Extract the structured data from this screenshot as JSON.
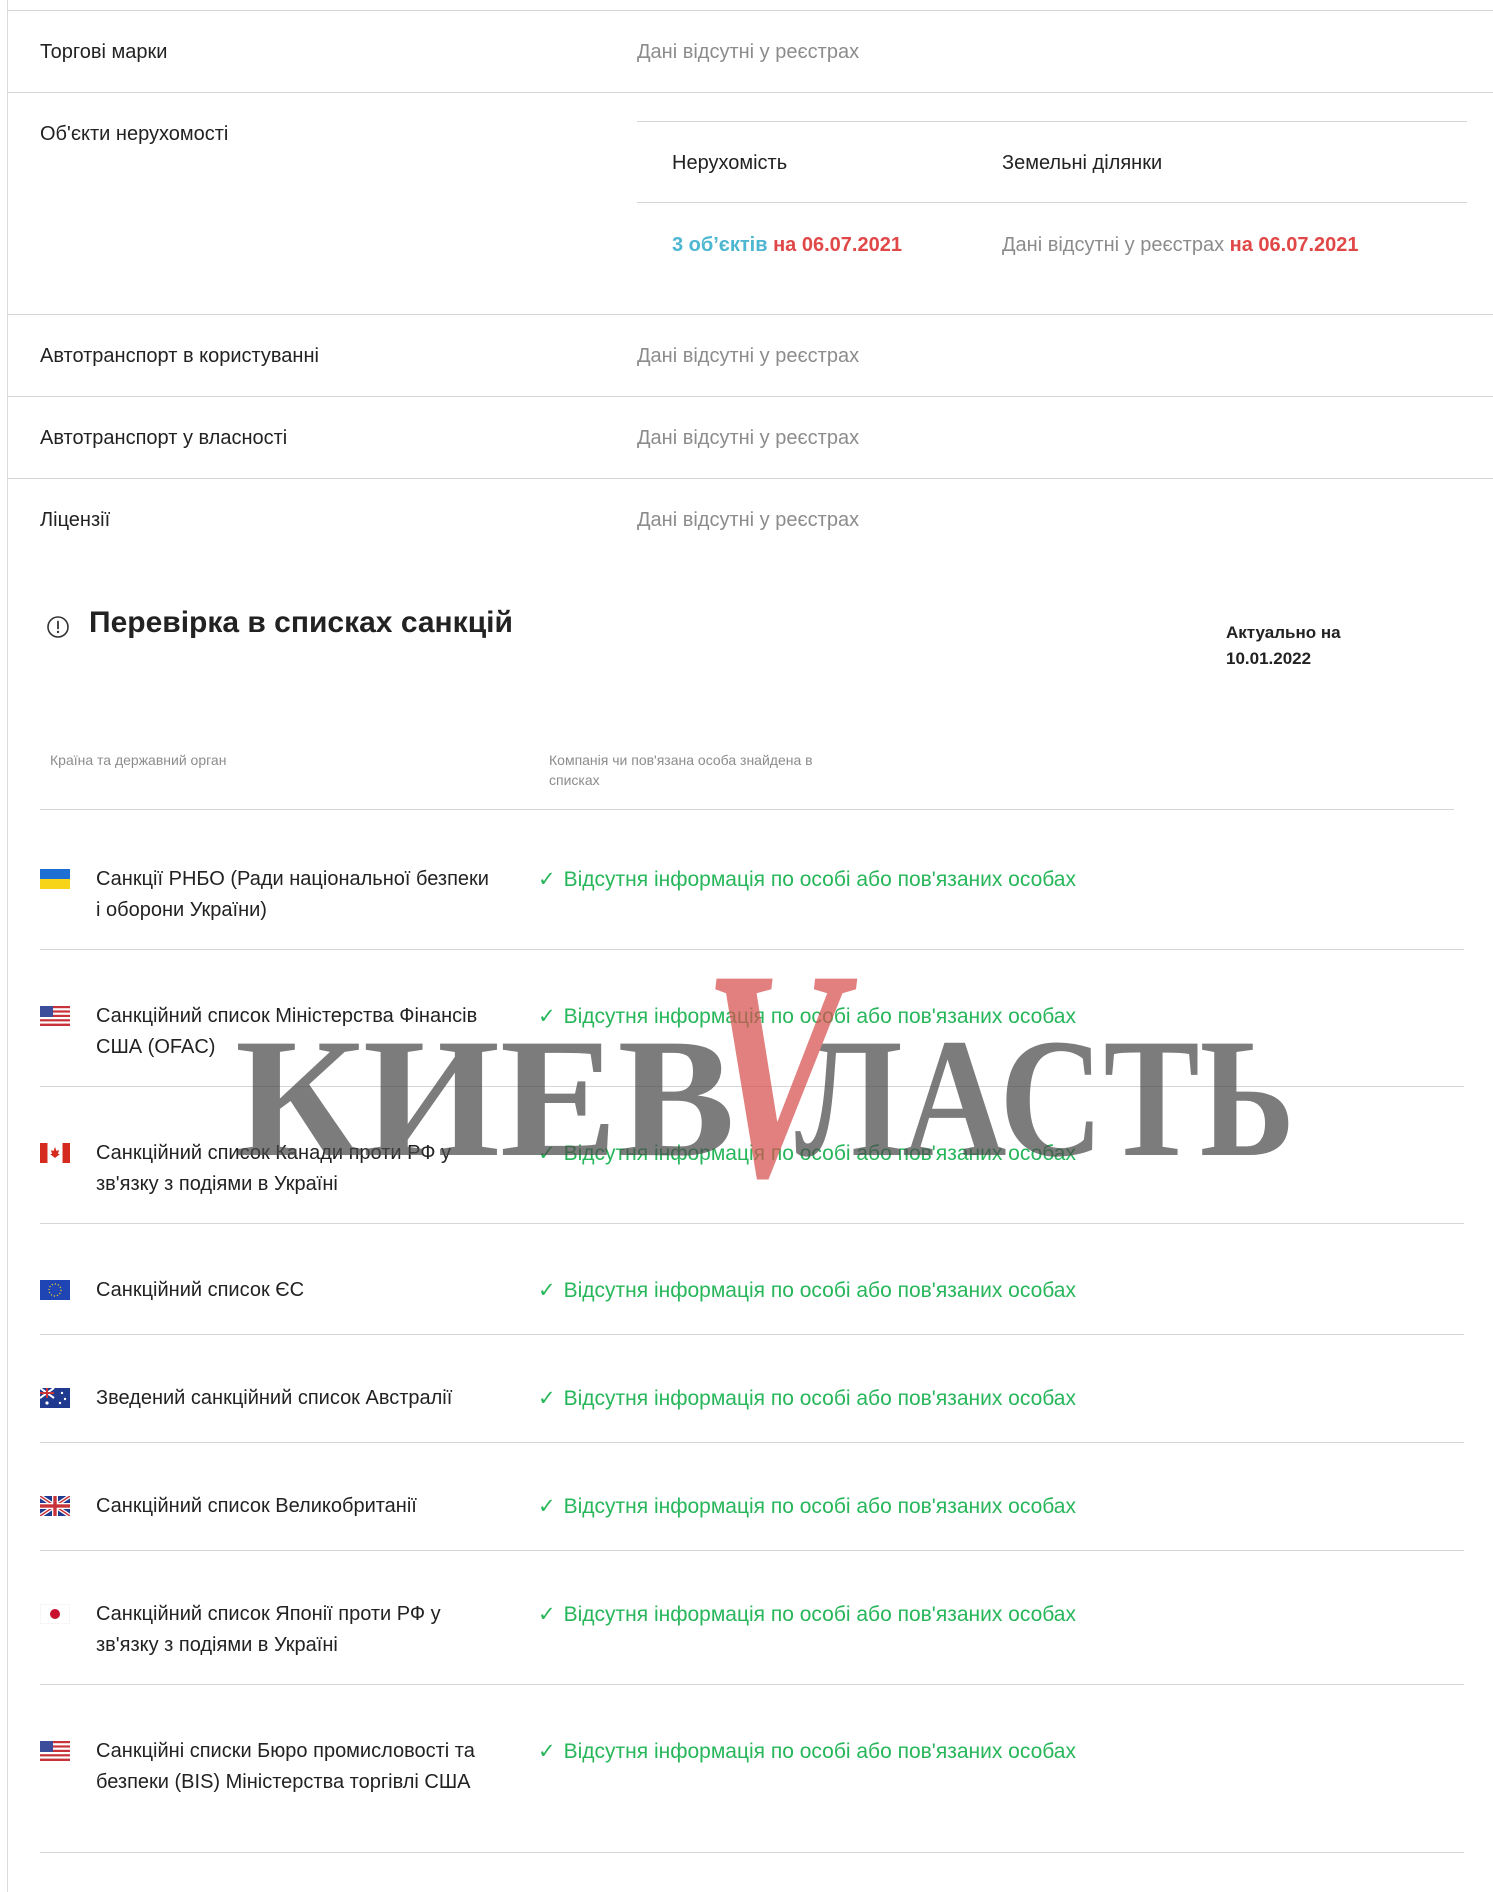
{
  "registry": {
    "no_data": "Дані відсутні у реєстрах",
    "trademarks_label": "Торгові марки",
    "real_estate_label": "Об'єкти нерухомості",
    "vehicles_use_label": "Автотранспорт в користуванні",
    "vehicles_own_label": "Автотранспорт у власності",
    "licenses_label": "Ліцензії",
    "real_estate": {
      "col_property": "Нерухомість",
      "col_land": "Земельні ділянки",
      "property_count": "3 об’єктів",
      "property_date": "на 06.07.2021",
      "land_value": "Дані відсутні у реєстрах",
      "land_date": "на 06.07.2021"
    }
  },
  "sanctions": {
    "title": "Перевірка в списках санкцій",
    "actual_label": "Актуально на",
    "actual_date": "10.01.2022",
    "col_country": "Країна та державний орган",
    "col_found_line1": "Компанія чи пов'язана особа знайдена в",
    "col_found_line2": "списках",
    "status_text": "Відсутня інформація по особі або пов'язаних особах",
    "lists": [
      {
        "name": "Санкції РНБО (Ради національної безпеки і оборони України)",
        "flag": "ukraine-flag-icon"
      },
      {
        "name": "Санкційний список Міністерства Фінансів США (OFAC)",
        "flag": "usa-flag-icon"
      },
      {
        "name": "Санкційний список Канади проти РФ у зв'язку з подіями в Україні",
        "flag": "canada-flag-icon"
      },
      {
        "name": "Санкційний список ЄС",
        "flag": "eu-flag-icon"
      },
      {
        "name": "Зведений санкційний список Австралії",
        "flag": "australia-flag-icon"
      },
      {
        "name": "Санкційний список Великобританії",
        "flag": "uk-flag-icon"
      },
      {
        "name": "Санкційний список Японії проти РФ у зв'язку з подіями в Україні",
        "flag": "japan-flag-icon"
      },
      {
        "name": "Санкційні списки Бюро промисловості та безпеки (BIS) Міністерства торгівлі США",
        "flag": "usa-flag-icon"
      }
    ]
  },
  "watermark": {
    "text": "КИЕВ ЛАСТЬ",
    "letter": "V"
  }
}
